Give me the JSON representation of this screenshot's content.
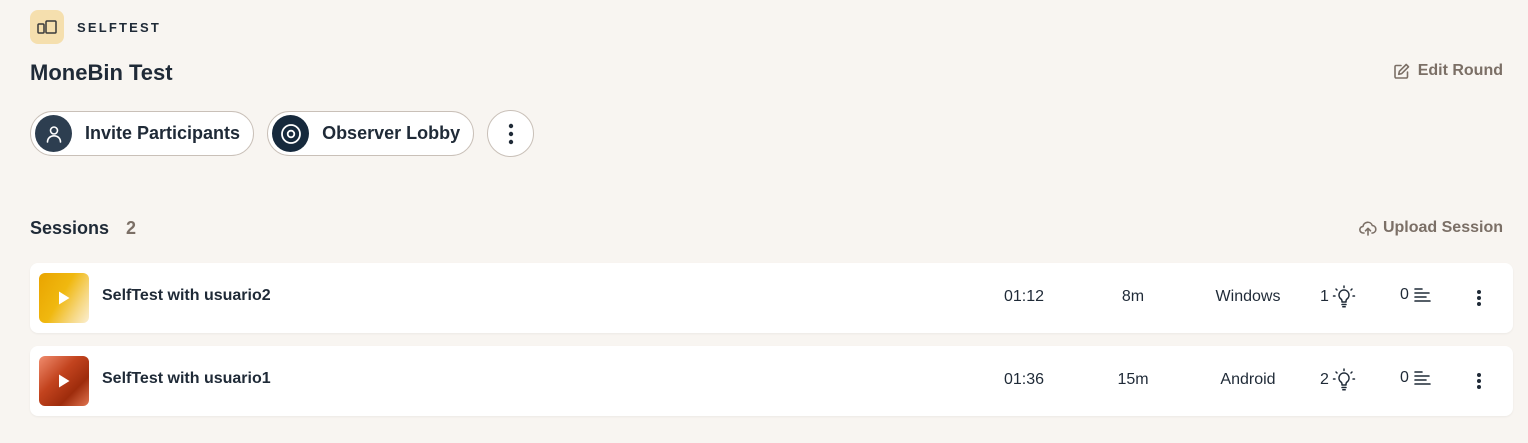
{
  "brand": {
    "name": "SELFTEST",
    "logo_icon": "split-layout-icon",
    "logo_bg": "#f5dfae"
  },
  "round": {
    "title": "MoneBin Test",
    "edit_label": "Edit Round",
    "edit_icon": "edit-icon"
  },
  "actions": {
    "invite_label": "Invite Participants",
    "invite_icon": "person-icon",
    "observer_label": "Observer Lobby",
    "observer_icon": "eye-icon",
    "more_icon": "more-vertical-icon"
  },
  "sessions": {
    "title": "Sessions",
    "count": "2",
    "upload_label": "Upload Session",
    "upload_icon": "cloud-upload-icon",
    "rows": [
      {
        "name": "SelfTest with usuario2",
        "time": "01:12",
        "duration": "8m",
        "os": "Windows",
        "insights": "1",
        "notes": "0",
        "thumb_color": "#f0b80f"
      },
      {
        "name": "SelfTest with usuario1",
        "time": "01:36",
        "duration": "15m",
        "os": "Android",
        "insights": "2",
        "notes": "0",
        "thumb_color": "#c2431e"
      }
    ]
  },
  "colors": {
    "background": "#f8f5f1",
    "text": "#1f2a37",
    "muted": "#7b6f66",
    "pill_icon_bg": "#2d3e50"
  }
}
